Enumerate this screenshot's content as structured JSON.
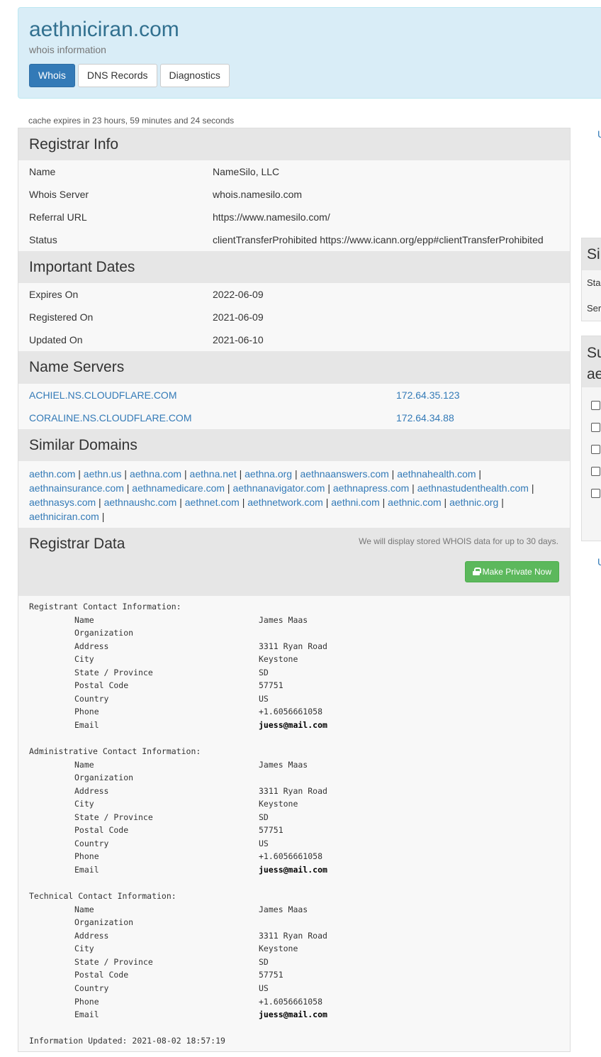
{
  "header": {
    "title": "aethniciran.com",
    "subtitle": "whois information",
    "tabs": [
      {
        "label": "Whois",
        "active": true
      },
      {
        "label": "DNS Records",
        "active": false
      },
      {
        "label": "Diagnostics",
        "active": false
      }
    ]
  },
  "cache_note": "cache expires in 23 hours, 59 minutes and 24 seconds",
  "registrar_info": {
    "heading": "Registrar Info",
    "rows": [
      {
        "key": "Name",
        "value": "NameSilo, LLC"
      },
      {
        "key": "Whois Server",
        "value": "whois.namesilo.com"
      },
      {
        "key": "Referral URL",
        "value": "https://www.namesilo.com/"
      },
      {
        "key": "Status",
        "value": "clientTransferProhibited https://www.icann.org/epp#clientTransferProhibited"
      }
    ]
  },
  "important_dates": {
    "heading": "Important Dates",
    "rows": [
      {
        "key": "Expires On",
        "value": "2022-06-09"
      },
      {
        "key": "Registered On",
        "value": "2021-06-09"
      },
      {
        "key": "Updated On",
        "value": "2021-06-10"
      }
    ]
  },
  "name_servers": {
    "heading": "Name Servers",
    "rows": [
      {
        "host": "ACHIEL.NS.CLOUDFLARE.COM",
        "ip": "172.64.35.123"
      },
      {
        "host": "CORALINE.NS.CLOUDFLARE.COM",
        "ip": "172.64.34.88"
      }
    ]
  },
  "similar_domains": {
    "heading": "Similar Domains",
    "domains": [
      "aethn.com",
      "aethn.us",
      "aethna.com",
      "aethna.net",
      "aethna.org",
      "aethnaanswers.com",
      "aethnahealth.com",
      "aethnainsurance.com",
      "aethnamedicare.com",
      "aethnanavigator.com",
      "aethnapress.com",
      "aethnastudenthealth.com",
      "aethnasys.com",
      "aethnaushc.com",
      "aethnet.com",
      "aethnetwork.com",
      "aethni.com",
      "aethnic.com",
      "aethnic.org",
      "aethniciran.com"
    ]
  },
  "registrar_data": {
    "heading": "Registrar Data",
    "note": "We will display stored WHOIS data for up to 30 days.",
    "button": "Make Private Now",
    "contacts": [
      {
        "title": "Registrant Contact Information:",
        "fields": [
          {
            "key": "Name",
            "value": "James Maas"
          },
          {
            "key": "Organization",
            "value": ""
          },
          {
            "key": "Address",
            "value": "3311 Ryan Road"
          },
          {
            "key": "City",
            "value": "Keystone"
          },
          {
            "key": "State / Province",
            "value": "SD"
          },
          {
            "key": "Postal Code",
            "value": "57751"
          },
          {
            "key": "Country",
            "value": "US"
          },
          {
            "key": "Phone",
            "value": "+1.6056661058"
          },
          {
            "key": "Email",
            "value": "juess@mail.com"
          }
        ]
      },
      {
        "title": "Administrative Contact Information:",
        "fields": [
          {
            "key": "Name",
            "value": "James Maas"
          },
          {
            "key": "Organization",
            "value": ""
          },
          {
            "key": "Address",
            "value": "3311 Ryan Road"
          },
          {
            "key": "City",
            "value": "Keystone"
          },
          {
            "key": "State / Province",
            "value": "SD"
          },
          {
            "key": "Postal Code",
            "value": "57751"
          },
          {
            "key": "Country",
            "value": "US"
          },
          {
            "key": "Phone",
            "value": "+1.6056661058"
          },
          {
            "key": "Email",
            "value": "juess@mail.com"
          }
        ]
      },
      {
        "title": "Technical Contact Information:",
        "fields": [
          {
            "key": "Name",
            "value": "James Maas"
          },
          {
            "key": "Organization",
            "value": ""
          },
          {
            "key": "Address",
            "value": "3311 Ryan Road"
          },
          {
            "key": "City",
            "value": "Keystone"
          },
          {
            "key": "State / Province",
            "value": "SD"
          },
          {
            "key": "Postal Code",
            "value": "57751"
          },
          {
            "key": "Country",
            "value": "US"
          },
          {
            "key": "Phone",
            "value": "+1.6056661058"
          },
          {
            "key": "Email",
            "value": "juess@mail.com"
          }
        ]
      }
    ],
    "updated": "Information Updated: 2021-08-02 18:57:19"
  },
  "sidebar": {
    "link_top": "U",
    "panel1": {
      "heading": "Si",
      "rows": [
        "Sta",
        "Ser"
      ]
    },
    "panel2": {
      "heading_line1": "Su",
      "heading_line2": "ae"
    },
    "link_bottom": "U"
  },
  "colors": {
    "header_bg": "#d9edf7",
    "title": "#31708f",
    "link": "#337ab7",
    "active_tab": "#337ab7",
    "section_bg": "#e6e6e6",
    "row_bg": "#f8f8f8",
    "private_button": "#5cb85c"
  }
}
